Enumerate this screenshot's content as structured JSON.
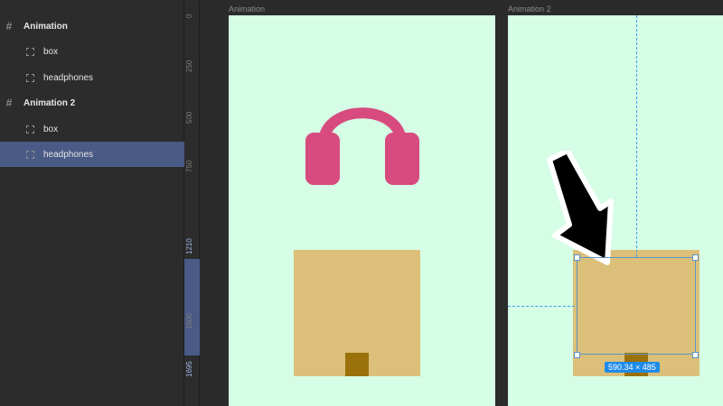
{
  "layers": [
    {
      "label": "Animation",
      "kind": "frame",
      "selected": false
    },
    {
      "label": "box",
      "kind": "child",
      "selected": false
    },
    {
      "label": "headphones",
      "kind": "child",
      "selected": false
    },
    {
      "label": "Animation 2",
      "kind": "frame",
      "selected": false
    },
    {
      "label": "box",
      "kind": "child",
      "selected": false
    },
    {
      "label": "headphones",
      "kind": "child",
      "selected": true
    }
  ],
  "ruler": {
    "labels": [
      "0",
      "250",
      "500",
      "750",
      "1210",
      "1500",
      "1695"
    ]
  },
  "canvas": {
    "frame1_title": "Animation",
    "frame2_title": "Animation 2",
    "size_badge": "590.34 × 485"
  },
  "colors": {
    "frame_bg": "#d6fde6",
    "headphones": "#d74b7f",
    "box": "#dcc079",
    "box_tape": "#9a710b",
    "selection": "#4a5a86",
    "guide": "#3aa0e8"
  }
}
